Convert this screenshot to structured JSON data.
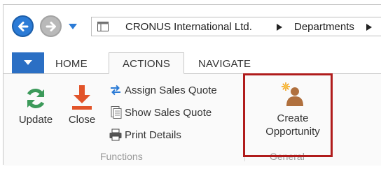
{
  "nav": {
    "back_icon": "back-arrow-icon",
    "forward_icon": "forward-arrow-icon",
    "history_icon": "chevron-down-icon"
  },
  "address": {
    "icon": "page-icon",
    "crumbs": [
      "CRONUS International Ltd.",
      "Departments"
    ],
    "separator_icon": "triangle-right-icon"
  },
  "tabs": {
    "app_menu_icon": "chevron-down-icon",
    "home": "HOME",
    "actions": "ACTIONS",
    "navigate": "NAVIGATE",
    "active": "ACTIONS"
  },
  "ribbon": {
    "functions": {
      "label": "Functions",
      "update": "Update",
      "close": "Close",
      "assign_sales_quote": "Assign Sales Quote",
      "show_sales_quote": "Show Sales Quote",
      "print_details": "Print Details"
    },
    "general": {
      "label": "General",
      "create_line1": "Create",
      "create_line2": "Opportunity"
    }
  },
  "colors": {
    "accent_blue": "#2b6fc4",
    "update_green": "#3c9a5a",
    "close_orange": "#e2542a",
    "highlight_red": "#b01c1c"
  }
}
